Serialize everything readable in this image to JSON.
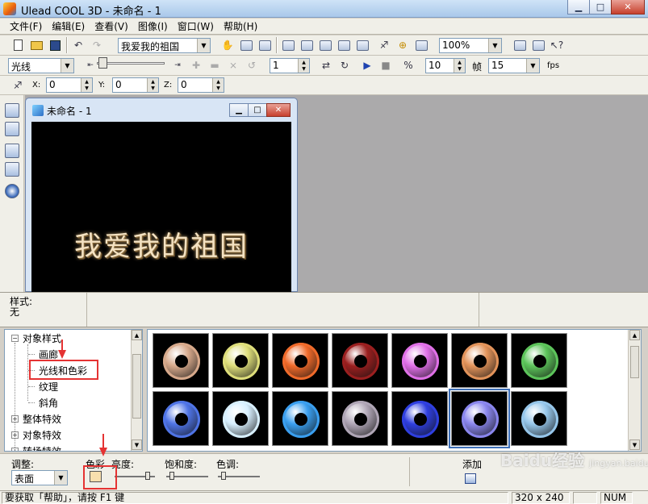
{
  "window": {
    "title": "Ulead COOL 3D - 未命名 - 1"
  },
  "menu": [
    "文件(F)",
    "编辑(E)",
    "查看(V)",
    "图像(I)",
    "窗口(W)",
    "帮助(H)"
  ],
  "toolbar1": {
    "object_combo": "我爱我的祖国",
    "zoom_combo": "100%"
  },
  "toolbar2": {
    "light_combo": "光线",
    "frame_value": "1",
    "frames_count": "10",
    "frames_label": "帧",
    "fps_value": "15",
    "fps_label": "fps"
  },
  "toolbar3": {
    "x_label": "X:",
    "x_value": "0",
    "y_label": "Y:",
    "y_value": "0",
    "z_label": "Z:",
    "z_value": "0"
  },
  "document": {
    "title": "未命名 - 1",
    "scene_text": "我爱我的祖国"
  },
  "props": {
    "style_label": "样式:",
    "style_value": "无"
  },
  "tree": {
    "items": [
      "对象样式",
      "画廊",
      "光线和色彩",
      "纹理",
      "斜角",
      "整体特效",
      "对象特效",
      "转场特效"
    ]
  },
  "gallery": {
    "colors": [
      "#d7a98b",
      "#dede7a",
      "#f06a2a",
      "#9b1f1f",
      "#e070e8",
      "#e2935a",
      "#5cc45a",
      "#4f74e6",
      "#d8f0ff",
      "#3a9ff0",
      "#b0a6b6",
      "#2f3fe0",
      "#8a86ee",
      "#96c6ea"
    ]
  },
  "bottom": {
    "adjust_label": "调整:",
    "surface_combo": "表面",
    "color_label": "色彩",
    "brightness_label": "亮度:",
    "saturation_label": "饱和度:",
    "hue_label": "色调:",
    "add_label": "添加"
  },
  "status": {
    "hint": "要获取「帮助」，请按 F1 键",
    "size": "320 x 240",
    "num": "NUM"
  },
  "watermark": {
    "brand": "Baidu经验",
    "url": "jingyan.baidu.com"
  },
  "colors": {
    "annotation": "#e53333",
    "title_gradient_top": "#cfe3f7"
  }
}
